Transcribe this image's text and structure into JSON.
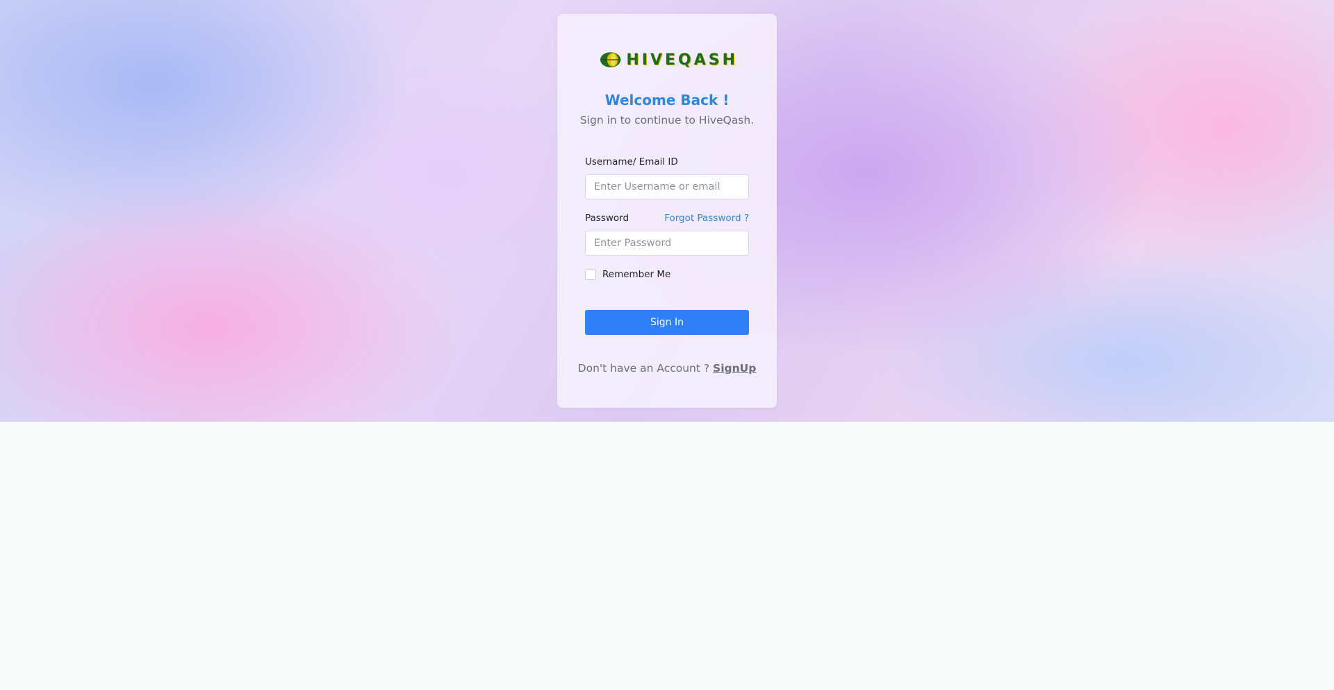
{
  "brand": {
    "logo_text": "HIVEQASH",
    "logo_icon": "leaf-logo-icon"
  },
  "login": {
    "title": "Welcome Back !",
    "subtitle": "Sign in to continue to HiveQash.",
    "username_label": "Username/ Email ID",
    "username_placeholder": "Enter Username or email",
    "username_value": "",
    "password_label": "Password",
    "forgot_password": "Forgot Password ?",
    "password_placeholder": "Enter Password",
    "password_value": "",
    "remember_label": "Remember Me",
    "remember_checked": false,
    "signin_button": "Sign In",
    "footer_prompt": "Don't have an Account ?",
    "signup_link": "SignUp"
  },
  "colors": {
    "accent": "#2f86e0",
    "button": "#2f7ff6",
    "logo_green": "#1f6b20",
    "logo_yellow": "#d8b800",
    "page_background": "#f9fafa"
  }
}
